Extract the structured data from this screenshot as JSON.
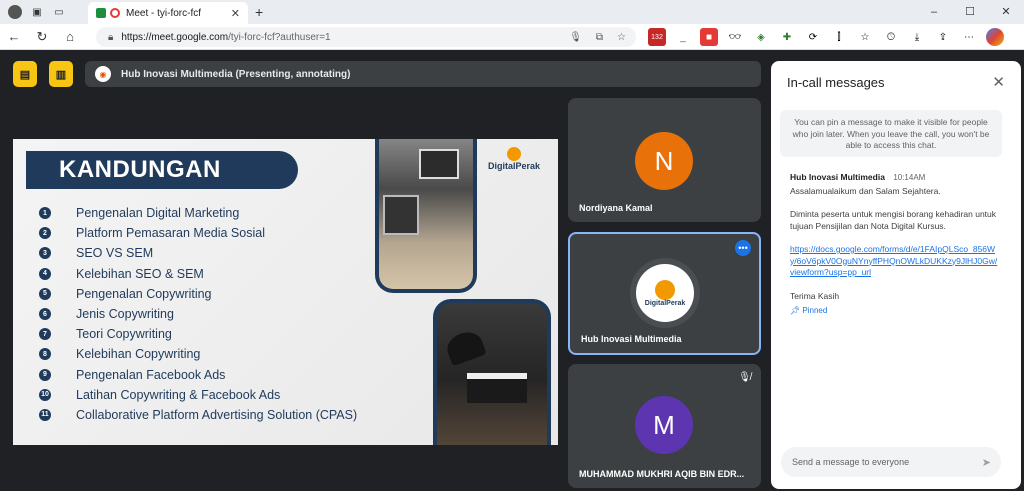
{
  "browser": {
    "tab_title": "Meet - tyi-forc-fcf",
    "url_main": "https://meet.google.com",
    "url_rest": "/tyi-forc-fcf?authuser=1",
    "new_tab": "+",
    "window_controls": [
      "–",
      "☐",
      "✕"
    ],
    "extension_badge": "132"
  },
  "meet": {
    "presenting_title": "Hub Inovasi Multimedia (Presenting, annotating)"
  },
  "slide": {
    "heading": "KANDUNGAN",
    "logo": "DigitalPerak",
    "items": [
      {
        "num": "1",
        "text": "Pengenalan Digital Marketing"
      },
      {
        "num": "2",
        "text": "Platform Pemasaran Media Sosial"
      },
      {
        "num": "3",
        "text": "SEO VS SEM"
      },
      {
        "num": "4",
        "text": "Kelebihan SEO & SEM"
      },
      {
        "num": "5",
        "text": "Pengenalan Copywriting"
      },
      {
        "num": "6",
        "text": "Jenis Copywriting"
      },
      {
        "num": "7",
        "text": "Teori Copywriting"
      },
      {
        "num": "8",
        "text": "Kelebihan Copywriting"
      },
      {
        "num": "9",
        "text": "Pengenalan Facebook Ads"
      },
      {
        "num": "10",
        "text": "Latihan Copywriting & Facebook Ads"
      },
      {
        "num": "11",
        "text": "Collaborative Platform Advertising Solution (CPAS)"
      }
    ]
  },
  "participants": [
    {
      "name": "Nordiyana Kamal",
      "initial": "N",
      "color": "#e8710a"
    },
    {
      "name": "Hub Inovasi Multimedia",
      "logo": "DigitalPerak"
    },
    {
      "name": "MUHAMMAD MUKHRI AQIB BIN EDR...",
      "initial": "M",
      "color": "#5e35b1"
    }
  ],
  "chat": {
    "title": "In-call messages",
    "note": "You can pin a message to make it visible for people who join later. When you leave the call, you won't be able to access this chat.",
    "message": {
      "sender": "Hub Inovasi Multimedia",
      "time": "10:14AM",
      "line1": "Assalamualaikum dan Salam Sejahtera.",
      "line2": "Diminta peserta untuk mengisi borang kehadiran untuk tujuan Pensijilan dan Nota Digital Kursus.",
      "link": "https://docs.google.com/forms/d/e/1FAIpQLSco_856Wy/6oV6pkV0OguNYnyffPHQnOWLkDUKKzy9JlHJ0Gw/viewform?usp=pp_url",
      "sign": "Terima Kasih",
      "pinned": "Pinned"
    },
    "input_placeholder": "Send a message to everyone"
  }
}
